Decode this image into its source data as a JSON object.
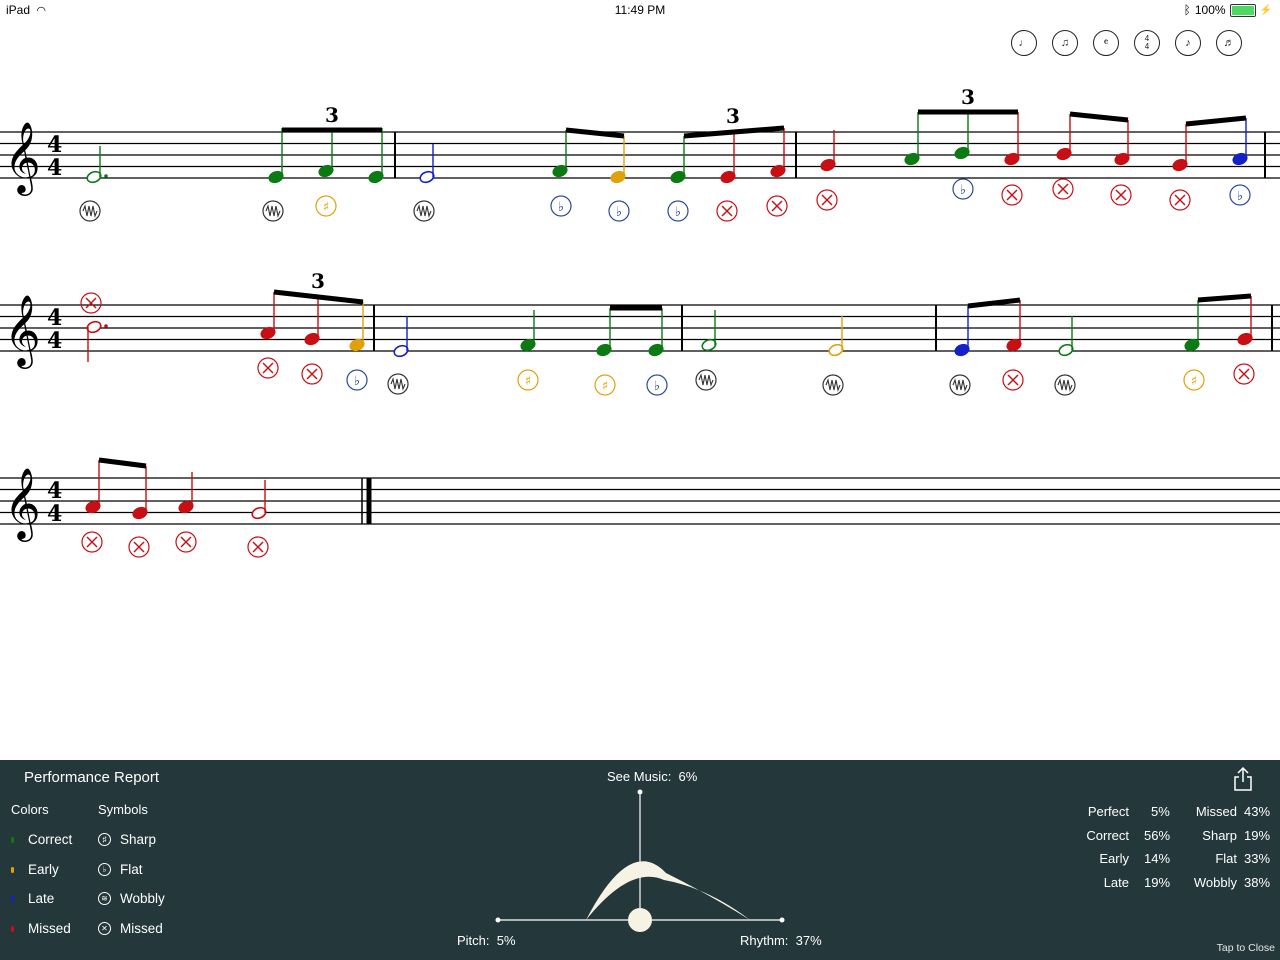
{
  "status_bar": {
    "device": "iPad",
    "time": "11:49 PM",
    "battery": "100%"
  },
  "toolbar": {
    "icons": [
      "note-view-icon",
      "staff-view-icon",
      "clef-icon",
      "time-signature-icon",
      "metronome-icon",
      "rhythm-icon"
    ]
  },
  "score": {
    "time_signature": "4/4",
    "tuplet_label": "3"
  },
  "report": {
    "title": "Performance Report",
    "colors_header": "Colors",
    "symbols_header": "Symbols",
    "colors": [
      {
        "label": "Correct",
        "color": "#0b7a12"
      },
      {
        "label": "Early",
        "color": "#e0a10a"
      },
      {
        "label": "Late",
        "color": "#1420c8"
      },
      {
        "label": "Missed",
        "color": "#c80f14"
      }
    ],
    "symbols": [
      {
        "label": "Sharp",
        "icon": "sharp-icon"
      },
      {
        "label": "Flat",
        "icon": "flat-icon"
      },
      {
        "label": "Wobbly",
        "icon": "wobbly-icon"
      },
      {
        "label": "Missed",
        "icon": "missed-icon"
      }
    ],
    "see_music_label": "See Music:",
    "see_music_value": "6%",
    "pitch_label": "Pitch:",
    "pitch_value": "5%",
    "rhythm_label": "Rhythm:",
    "rhythm_value": "37%",
    "stats_left": [
      {
        "label": "Perfect",
        "value": "5%"
      },
      {
        "label": "Correct",
        "value": "56%"
      },
      {
        "label": "Early",
        "value": "14%"
      },
      {
        "label": "Late",
        "value": "19%"
      }
    ],
    "stats_right": [
      {
        "label": "Missed",
        "value": "43%"
      },
      {
        "label": "Sharp",
        "value": "19%"
      },
      {
        "label": "Flat",
        "value": "33%"
      },
      {
        "label": "Wobbly",
        "value": "38%"
      }
    ],
    "tap_to_close": "Tap to Close"
  }
}
